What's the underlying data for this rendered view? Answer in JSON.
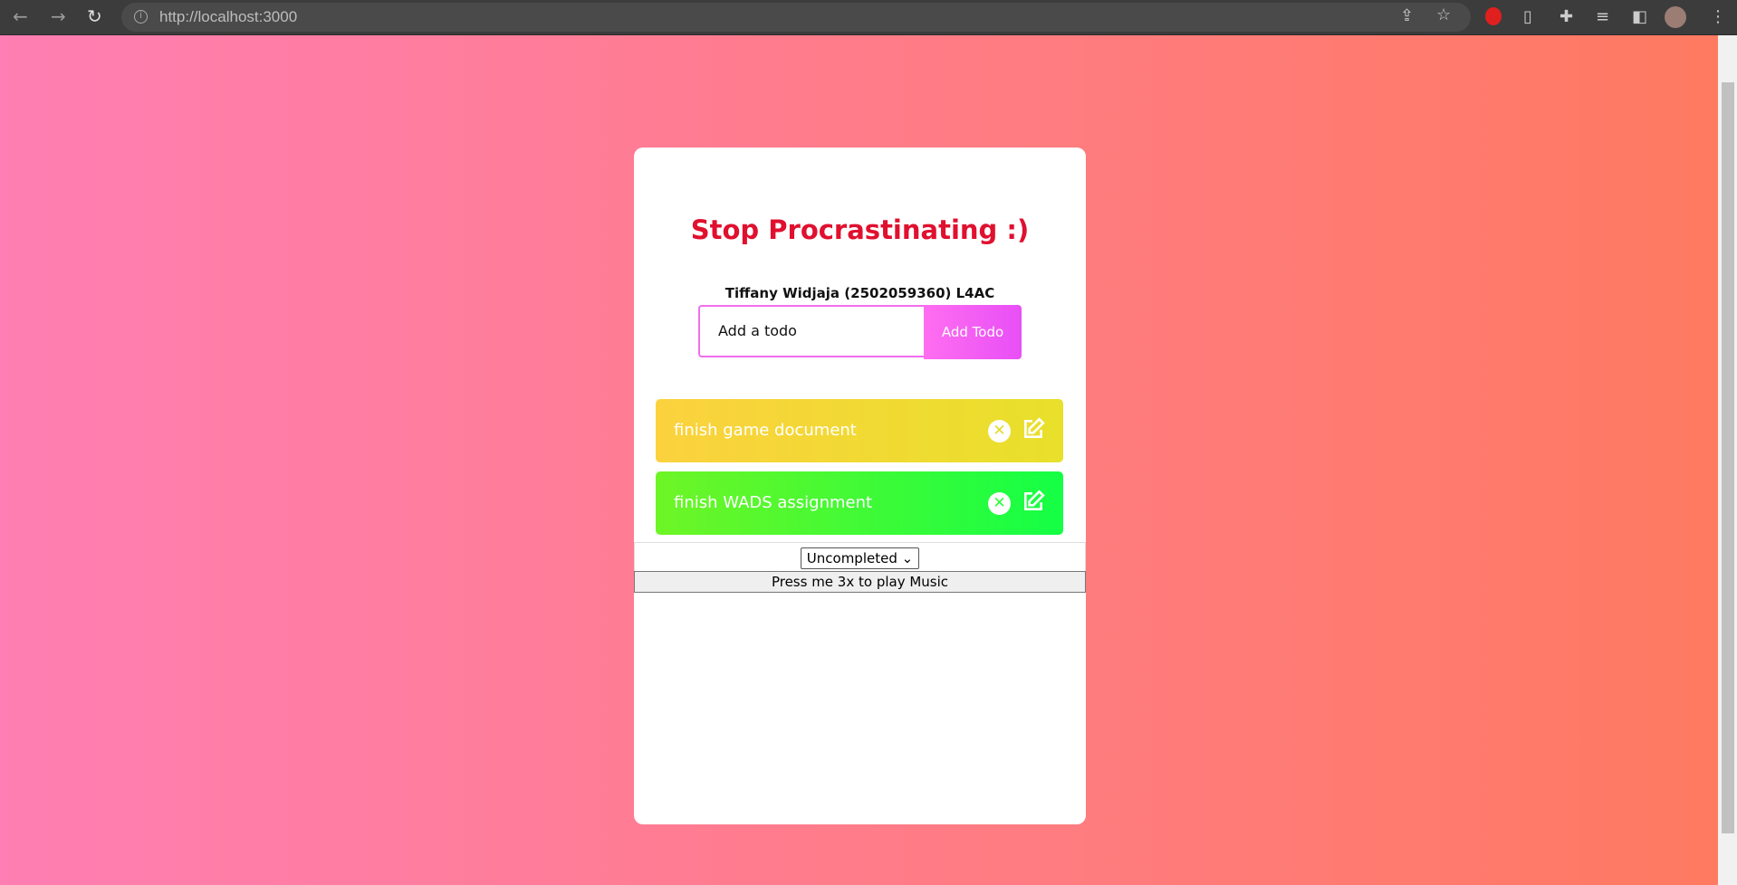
{
  "browser": {
    "url": "http://localhost:3000"
  },
  "app": {
    "title": "Stop Procrastinating :)",
    "author": "Tiffany Widjaja (2502059360) L4AC",
    "input_placeholder": "Add a todo",
    "add_label": "Add Todo",
    "todos": [
      {
        "text": "finish game document",
        "color": "#f4d936"
      },
      {
        "text": "finish WADS assignment",
        "color": "#2cff36"
      }
    ],
    "filter_selected": "Uncompleted",
    "music_button": "Press me 3x to play Music"
  }
}
